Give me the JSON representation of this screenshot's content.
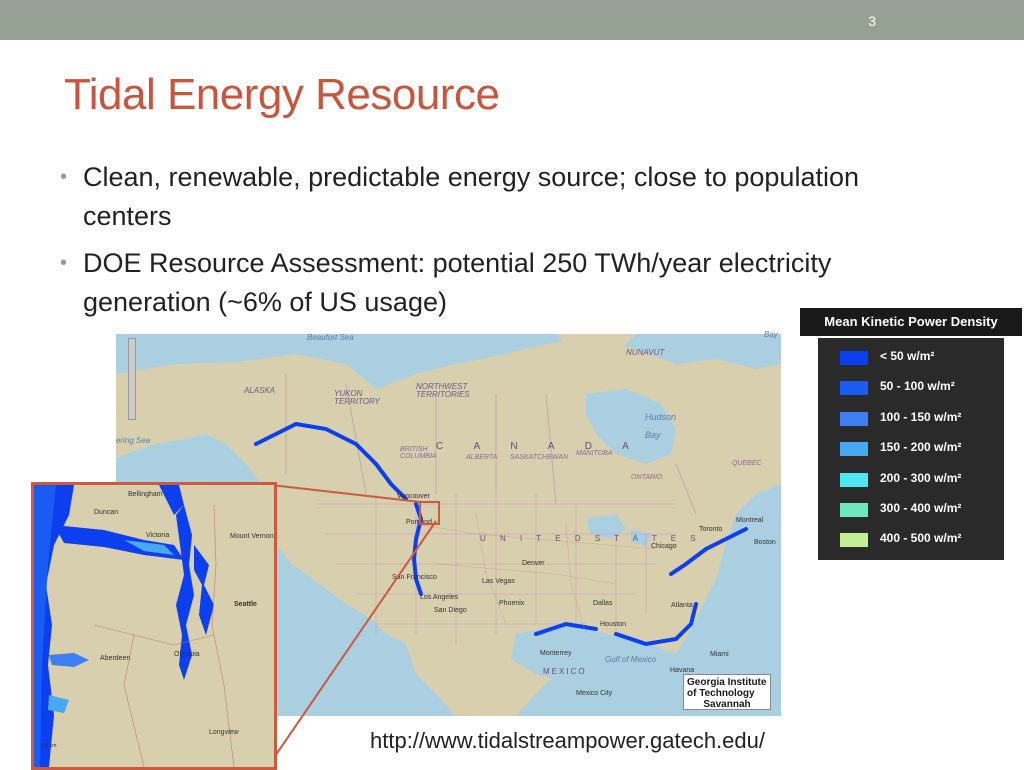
{
  "slide": {
    "number": "3",
    "title": "Tidal Energy Resource",
    "bullets": [
      "Clean, renewable, predictable energy source; close to population centers",
      "DOE Resource Assessment: potential 250 TWh/year electricity generation (~6% of US usage)"
    ],
    "url": "http://www.tidalstreampower.gatech.edu/"
  },
  "legend": {
    "title": "Mean Kinetic Power Density",
    "items": [
      {
        "label": "< 50 w/m²",
        "color": "#0b3ff0"
      },
      {
        "label": "50 - 100 w/m²",
        "color": "#1a5cf2"
      },
      {
        "label": "100 - 150 w/m²",
        "color": "#3d7ff2"
      },
      {
        "label": "150 - 200 w/m²",
        "color": "#49a8f2"
      },
      {
        "label": "200 - 300 w/m²",
        "color": "#4fe6ef"
      },
      {
        "label": "300 - 400 w/m²",
        "color": "#6fe6c0"
      },
      {
        "label": "400 - 500 w/m²",
        "color": "#c3ee94"
      }
    ]
  },
  "map": {
    "labels": {
      "beaufort": "Beaufort Sea",
      "bering": "ering Sea",
      "alaska": "ALASKA",
      "yukon": "YUKON TERRITORY",
      "nwt": "NORTHWEST TERRITORIES",
      "nunavut": "NUNAVUT",
      "hudson": "Hudson Bay",
      "canada": "C A N A D A",
      "bc": "BRITISH COLUMBIA",
      "alberta": "ALBERTA",
      "sask": "SASKATCHEWAN",
      "manitoba": "MANITOBA",
      "ontario": "ONTARIO",
      "quebec": "QUEBEC",
      "us": "U N I T E D   S T A T E S",
      "mexico": "MEXICO",
      "gulf": "Gulf of Mexico",
      "bay": "Bay",
      "vancouver": "Vancouver",
      "portland": "Portland",
      "sanfran": "San Francisco",
      "la": "Los Angeles",
      "sandiego": "San Diego",
      "lasvegas": "Las Vegas",
      "phoenix": "Phoenix",
      "denver": "Denver",
      "dallas": "Dallas",
      "houston": "Houston",
      "chicago": "Chicago",
      "toronto": "Toronto",
      "montreal": "Montreal",
      "boston": "Boston",
      "miami": "Miami",
      "atlanta": "Atlanta",
      "monterrey": "Monterrey",
      "mexicocity": "Mexico City",
      "havana": "Havana"
    },
    "logo": [
      "Georgia Institute",
      "of Technology",
      "Savannah"
    ]
  },
  "inset": {
    "labels": {
      "victoria": "Victoria",
      "seattle": "Seattle",
      "olympia": "Olympia",
      "bellingham": "Bellingham",
      "duncan": "Duncan",
      "mountvernon": "Mount Vernon",
      "aberdeen": "Aberdeen",
      "longview": "Longview",
      "scale": "100 km"
    }
  }
}
